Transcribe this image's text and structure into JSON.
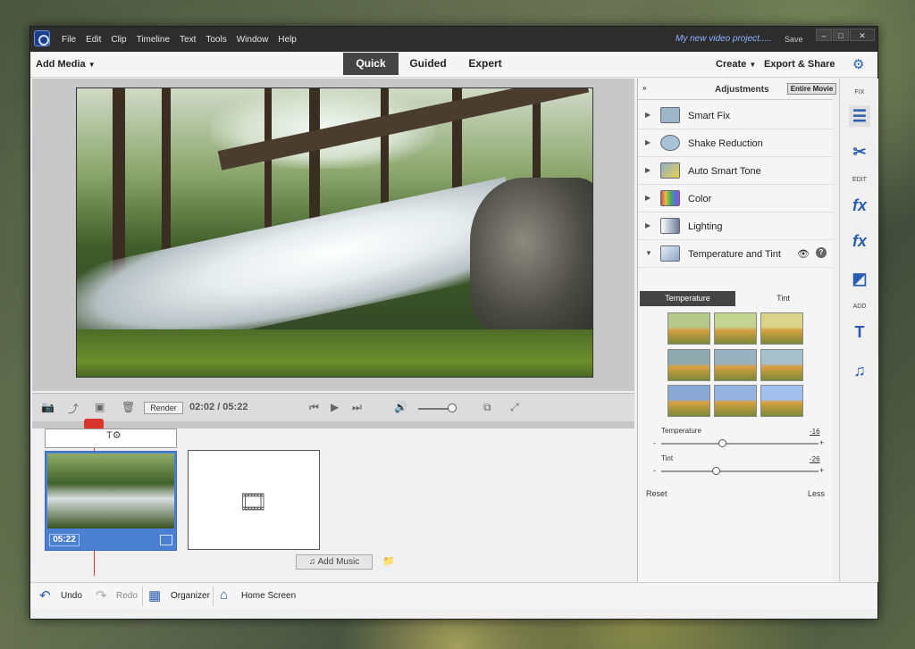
{
  "titlebar": {
    "menu": [
      "File",
      "Edit",
      "Clip",
      "Timeline",
      "Text",
      "Tools",
      "Window",
      "Help"
    ],
    "project_name": "My new video project.....",
    "save": "Save",
    "controls": [
      "–",
      "□",
      "✕"
    ]
  },
  "topbar": {
    "add_media": "Add Media",
    "tabs": [
      "Quick",
      "Guided",
      "Expert"
    ],
    "active_tab": "Quick",
    "create": "Create",
    "export_share": "Export & Share"
  },
  "playback": {
    "render": "Render",
    "timecode": "02:02 / 05:22"
  },
  "timeline": {
    "clip_duration": "05:22",
    "add_music": "Add Music"
  },
  "bottombar": {
    "undo": "Undo",
    "redo": "Redo",
    "organizer": "Organizer",
    "home_screen": "Home Screen"
  },
  "adjustments": {
    "title": "Adjustments",
    "scope": "Entire Movie",
    "items": [
      {
        "label": "Smart Fix",
        "icon": "smart-fix-icon"
      },
      {
        "label": "Shake Reduction",
        "icon": "shake-reduction-icon"
      },
      {
        "label": "Auto Smart Tone",
        "icon": "auto-smart-tone-icon"
      },
      {
        "label": "Color",
        "icon": "color-icon"
      },
      {
        "label": "Lighting",
        "icon": "lighting-icon"
      },
      {
        "label": "Temperature and Tint",
        "icon": "temperature-tint-icon"
      }
    ],
    "tabs": [
      "Temperature",
      "Tint"
    ],
    "active_tab": "Temperature",
    "temperature_label": "Temperature",
    "temperature_value": "-16",
    "tint_label": "Tint",
    "tint_value": "-26",
    "minus": "-",
    "plus": "+",
    "reset": "Reset",
    "less": "Less",
    "preset_colors": [
      "#b4c98a",
      "#c2d490",
      "#d9d48a",
      "#8fa9b0",
      "#98b3bf",
      "#a6c0cc",
      "#8aa8d6",
      "#93b2e0",
      "#a2c0ee"
    ]
  },
  "toolstrip": {
    "fix_label": "FIX",
    "edit_label": "EDIT",
    "add_label": "ADD"
  },
  "colors": {
    "accent": "#2a5db0",
    "playhead": "#d9332b",
    "clip": "#4a7fd1"
  }
}
